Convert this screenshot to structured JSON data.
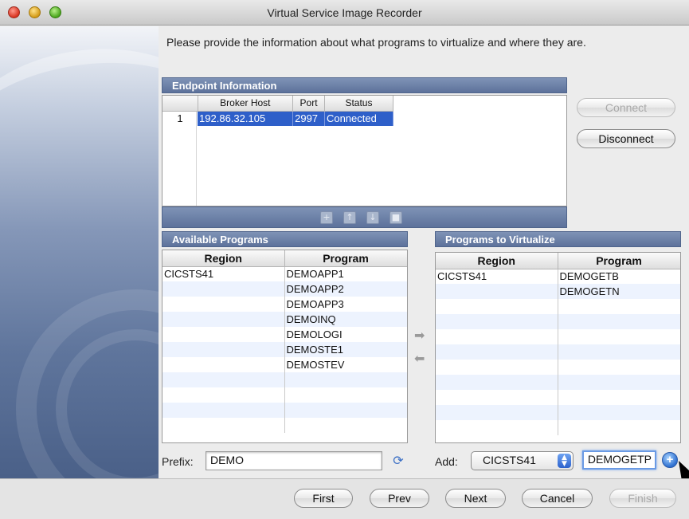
{
  "window": {
    "title": "Virtual Service Image Recorder"
  },
  "instructions": "Please provide the information about what programs to virtualize and where they are.",
  "endpoint": {
    "header": "Endpoint Information",
    "columns": [
      "Broker Host",
      "Port",
      "Status"
    ],
    "rows": [
      {
        "num": "1",
        "host": "192.86.32.105",
        "port": "2997",
        "status": "Connected"
      }
    ],
    "connect_label": "Connect",
    "disconnect_label": "Disconnect",
    "toolbar_icons": [
      "add-icon",
      "move-up-icon",
      "move-down-icon",
      "delete-icon"
    ]
  },
  "available": {
    "header": "Available Programs",
    "columns": [
      "Region",
      "Program"
    ],
    "rows": [
      {
        "region": "CICSTS41",
        "program": "DEMOAPP1"
      },
      {
        "region": "",
        "program": "DEMOAPP2"
      },
      {
        "region": "",
        "program": "DEMOAPP3"
      },
      {
        "region": "",
        "program": "DEMOINQ"
      },
      {
        "region": "",
        "program": "DEMOLOGI"
      },
      {
        "region": "",
        "program": "DEMOSTE1"
      },
      {
        "region": "",
        "program": "DEMOSTEV"
      },
      {
        "region": "",
        "program": ""
      },
      {
        "region": "",
        "program": ""
      },
      {
        "region": "",
        "program": ""
      },
      {
        "region": "",
        "program": ""
      }
    ],
    "prefix_label": "Prefix:",
    "prefix_value": "DEMO"
  },
  "virtualize": {
    "header": "Programs to Virtualize",
    "columns": [
      "Region",
      "Program"
    ],
    "rows": [
      {
        "region": "CICSTS41",
        "program": "DEMOGETB"
      },
      {
        "region": "",
        "program": "DEMOGETN"
      },
      {
        "region": "",
        "program": ""
      },
      {
        "region": "",
        "program": ""
      },
      {
        "region": "",
        "program": ""
      },
      {
        "region": "",
        "program": ""
      },
      {
        "region": "",
        "program": ""
      },
      {
        "region": "",
        "program": ""
      },
      {
        "region": "",
        "program": ""
      },
      {
        "region": "",
        "program": ""
      },
      {
        "region": "",
        "program": ""
      }
    ],
    "add_label": "Add:",
    "region_select": "CICSTS41",
    "program_input": "DEMOGETP"
  },
  "nav": {
    "first": "First",
    "prev": "Prev",
    "next": "Next",
    "cancel": "Cancel",
    "finish": "Finish"
  },
  "colors": {
    "accent": "#2e5fc9",
    "section_header": "#6b80a8"
  }
}
